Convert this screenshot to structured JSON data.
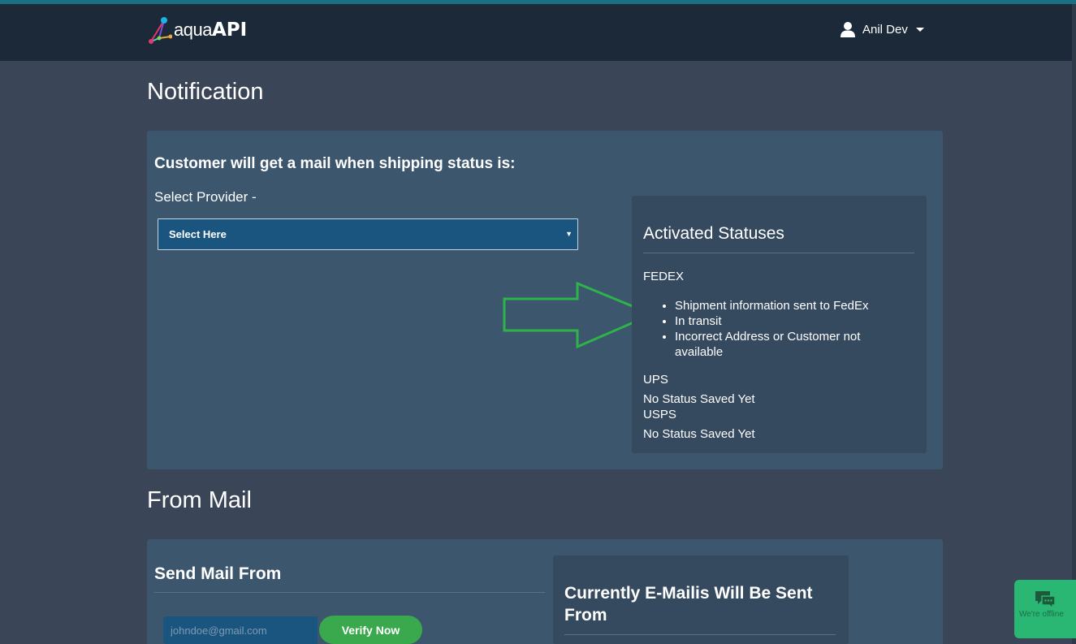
{
  "header": {
    "logo_prefix": "aqua",
    "logo_suffix": "API",
    "user_name": "Anil Dev"
  },
  "notification": {
    "heading": "Notification",
    "panel_title": "Customer will get a mail when shipping status is:",
    "select_label": "Select Provider -",
    "select_value": "Select Here",
    "activated": {
      "title": "Activated Statuses",
      "fedex": {
        "name": "FEDEX",
        "statuses": [
          "Shipment information sent to FedEx",
          "In transit",
          "Incorrect Address or Customer not available"
        ]
      },
      "ups": {
        "name": "UPS",
        "empty_text": "No Status Saved Yet"
      },
      "usps": {
        "name": "USPS",
        "empty_text": "No Status Saved Yet"
      }
    }
  },
  "from_mail": {
    "heading": "From Mail",
    "panel_title": "Send Mail From",
    "email_placeholder": "johndoe@gmail.com",
    "verify_label": "Verify Now",
    "current_title": "Currently E-Mailis Will Be Sent From"
  },
  "chat": {
    "status_text": "We're offline"
  },
  "colors": {
    "page_bg": "#3a4657",
    "navbar_bg": "#1b2938",
    "panel_bg": "#3c566d",
    "inner_box_bg": "#354a5f",
    "select_bg": "#1a5580",
    "verify_green": "#3aa84c",
    "chat_green": "#2ab673",
    "arrow_green": "#2db34a"
  }
}
